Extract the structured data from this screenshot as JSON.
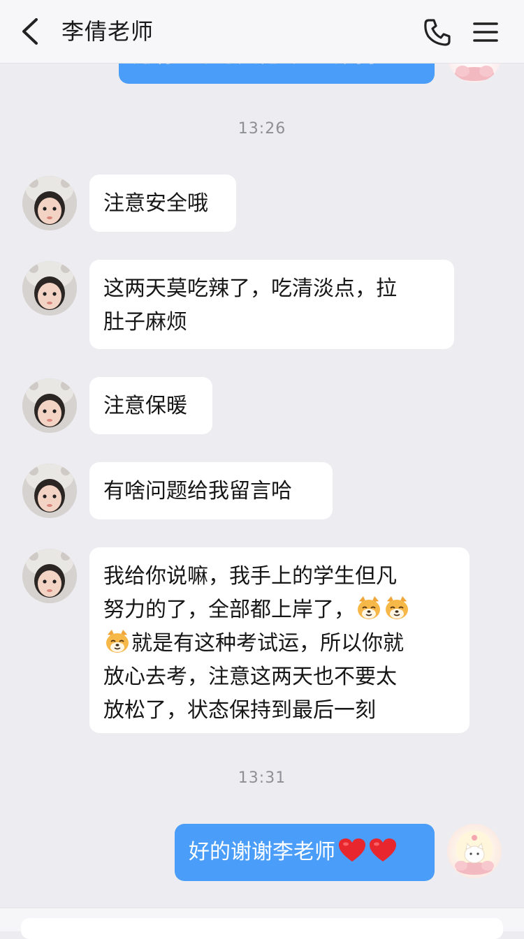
{
  "header": {
    "title": "李倩老师",
    "back_icon": "chevron-left-icon",
    "call_icon": "phone-icon",
    "menu_icon": "menu-icon"
  },
  "top_sent": {
    "text": "还有一个考其他专业的同学"
  },
  "timestamps": [
    "13:26",
    "13:31"
  ],
  "received": [
    {
      "text": "注意安全哦"
    },
    {
      "lines": [
        "这两天莫吃辣了，吃清淡点，拉",
        "肚子麻烦"
      ]
    },
    {
      "text": "注意保暖"
    },
    {
      "text": "有啥问题给我留言哈"
    },
    {
      "line1": "我给你说嘛，我手上的学生但凡",
      "line2": "努力的了，全部都上岸了，",
      "line3": "就是有这种考试运，所以你就",
      "line4": "放心去考，注意这两天也不要太",
      "line5": "放松了，状态保持到最后一刻",
      "emoji": "smiling-dog-emoji"
    }
  ],
  "sent": {
    "text": "好的谢谢李老师",
    "emoji": "red-heart-emoji",
    "heart_color": "#e8262d"
  },
  "colors": {
    "bubble_out": "#4a9df8",
    "bubble_in": "#ffffff",
    "background": "#ececf1"
  }
}
